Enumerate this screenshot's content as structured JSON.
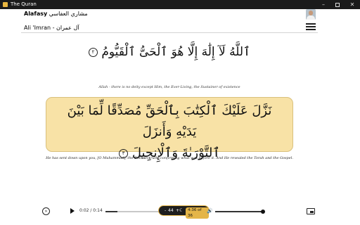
{
  "window": {
    "title": "The Quran"
  },
  "header": {
    "reciter_name": "Alafasy",
    "reciter_arabic": "مشاري العفاسي",
    "surah_label": "Ali 'Imran - آل عمران"
  },
  "ayahs": [
    {
      "arabic": "ٱللَّهُ لَآ إِلَٰهَ إِلَّا هُوَ ٱلْحَىُّ ٱلْقَيُّومُ",
      "number": "٢",
      "translation": "Allah - there is no deity except Him, the Ever-Living, the Sustainer of existence"
    },
    {
      "arabic_line1": "نَزَّلَ عَلَيْكَ ٱلْكِتَٰبَ بِٱلْحَقِّ مُصَدِّقًا لِّمَا بَيْنَ يَدَيْهِ وَأَنزَلَ",
      "arabic_line2": "ٱلتَّوْرَىٰةَ وَٱلْإِنجِيلَ",
      "number": "٣",
      "translation": "He has sent down upon you, [O Muhammad], the Book in truth, confirming what was before it. And He revealed the Torah and the Gospel."
    }
  ],
  "player": {
    "time": "0:02 / 0:14",
    "progress": 0.14,
    "font_minus": "-",
    "font_size": "44",
    "font_plus": "+",
    "ayah_counter": "4:36 of 36",
    "volume": 1.0
  },
  "colors": {
    "highlight": "#f8e2a6",
    "accent": "#e4b548"
  }
}
